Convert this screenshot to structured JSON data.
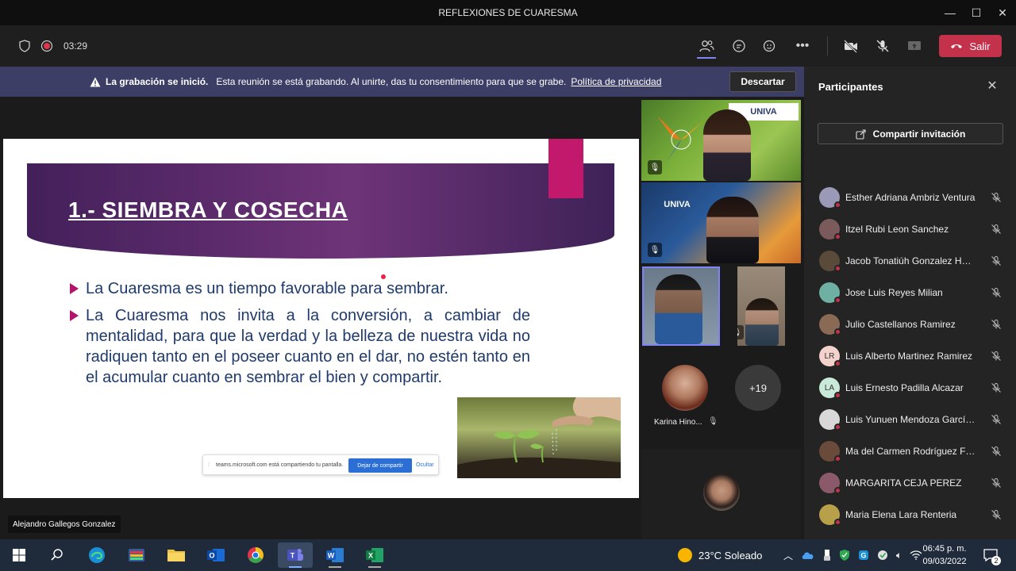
{
  "window": {
    "title": "REFLEXIONES DE CUARESMA"
  },
  "toolbar": {
    "timer": "03:29",
    "leave_label": "Salir"
  },
  "banner": {
    "bold": "La grabación se inició.",
    "text": "Esta reunión se está grabando. Al unirte, das tu consentimiento para que se grabe.",
    "link": "Política de privacidad",
    "dismiss": "Descartar"
  },
  "slide": {
    "title": "1.- SIEMBRA Y COSECHA",
    "bullets": [
      "La Cuaresma es un tiempo favorable para sembrar.",
      "La Cuaresma nos invita a la conversión, a cambiar de mentalidad, para que la verdad y la belleza de nuestra vida no radiquen tanto en el poseer cuanto en el dar, no estén tanto en el acumular cuanto en sembrar el bien y compartir."
    ]
  },
  "share_bar": {
    "text": "teams.microsoft.com está compartiendo tu pantalla.",
    "stop": "Dejar de compartir",
    "hide": "Ocultar"
  },
  "presenter": {
    "name": "Alejandro Gallegos Gonzalez"
  },
  "video": {
    "brand": "UNIVA",
    "tile_karina": "Karina Hino...",
    "more_count": "+19"
  },
  "panel": {
    "title": "Participantes",
    "invite": "Compartir invitación",
    "participants": [
      {
        "name": "Esther Adriana Ambriz Ventura",
        "initials": "",
        "color": "#9a9ab8"
      },
      {
        "name": "Itzel Rubi Leon Sanchez",
        "initials": "",
        "color": "#7a5a5a"
      },
      {
        "name": "Jacob Tonatiúh Gonzalez Herrera",
        "initials": "",
        "color": "#5a4a3a"
      },
      {
        "name": "Jose Luis Reyes Milian",
        "initials": "",
        "color": "#6fb0a5"
      },
      {
        "name": "Julio Castellanos Ramirez",
        "initials": "",
        "color": "#8a6a55"
      },
      {
        "name": "Luis Alberto Martinez Ramirez",
        "initials": "LR",
        "color": "#f3d2cc"
      },
      {
        "name": "Luis Ernesto Padilla Alcazar",
        "initials": "LA",
        "color": "#c9ead8"
      },
      {
        "name": "Luis Yunuen Mendoza García de...",
        "initials": "",
        "color": "#d8d8d8"
      },
      {
        "name": "Ma del Carmen Rodríguez Fermá...",
        "initials": "",
        "color": "#6a4a3a"
      },
      {
        "name": "MARGARITA CEJA PEREZ",
        "initials": "",
        "color": "#8a5a6a"
      },
      {
        "name": "Maria Elena Lara Renteria",
        "initials": "",
        "color": "#b8a04a"
      }
    ]
  },
  "taskbar": {
    "weather": "23°C  Soleado",
    "time": "06:45 p. m.",
    "date": "09/03/2022",
    "notifications": "2"
  }
}
